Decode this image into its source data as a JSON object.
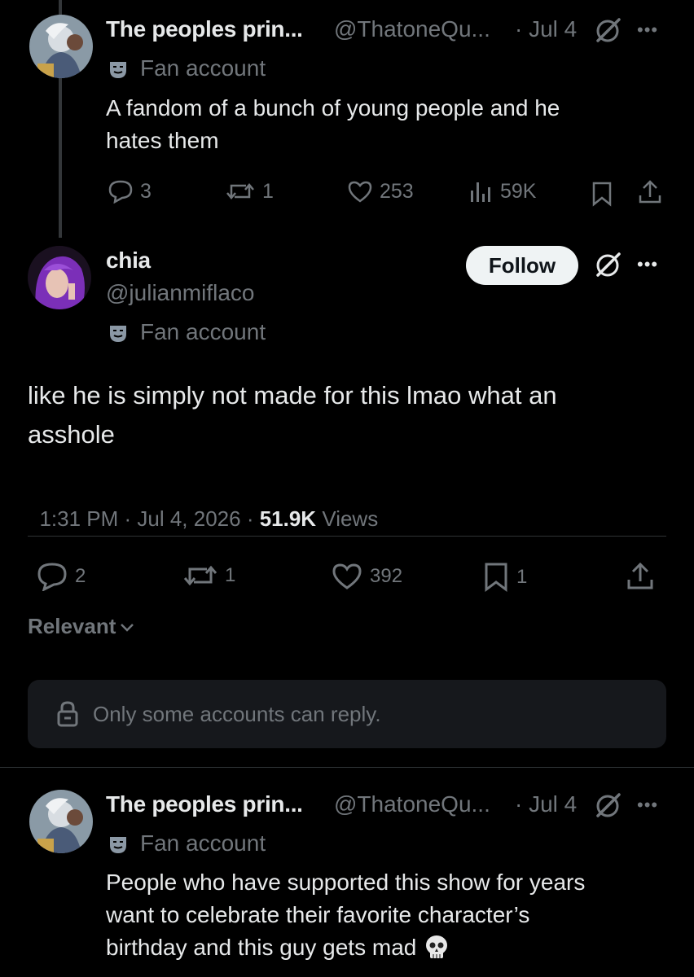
{
  "post1": {
    "name": "The peoples prin...",
    "handle": "@ThatoneQu...",
    "date": "· Jul 4",
    "label": "Fan account",
    "text_line1": "A fandom of a bunch of young people and he",
    "text_line2": "hates them",
    "replies": "3",
    "reposts": "1",
    "likes": "253",
    "views": "59K"
  },
  "main": {
    "name": "chia",
    "handle": "@julianmiflaco",
    "label": "Fan account",
    "follow_label": "Follow",
    "text_line1": "like he is simply not made for this lmao what an",
    "text_line2": "asshole",
    "timestamp": "1:31 PM · Jul 4, 2026 · ",
    "views_count": "51.9K",
    "views_label": " Views",
    "replies": "2",
    "reposts": "1",
    "likes": "392",
    "bookmarks": "1"
  },
  "sort": {
    "label": "Relevant"
  },
  "reply_notice": "Only some accounts can reply.",
  "post2": {
    "name": "The peoples prin...",
    "handle": "@ThatoneQu...",
    "date": "· Jul 4",
    "label": "Fan account",
    "text_line1": "People who have supported this show for years",
    "text_line2": "want to celebrate their favorite character’s",
    "text_line3": "birthday and this guy gets mad"
  },
  "colors": {
    "background": "#000000",
    "text": "#e7e9ea",
    "muted": "#71767b",
    "divider": "#2f3336"
  },
  "icons": [
    "grok-icon",
    "more-icon",
    "mask-icon",
    "reply-icon",
    "repost-icon",
    "like-icon",
    "views-icon",
    "bookmark-icon",
    "share-icon",
    "lock-icon",
    "chevron-down-icon",
    "skull-emoji"
  ]
}
